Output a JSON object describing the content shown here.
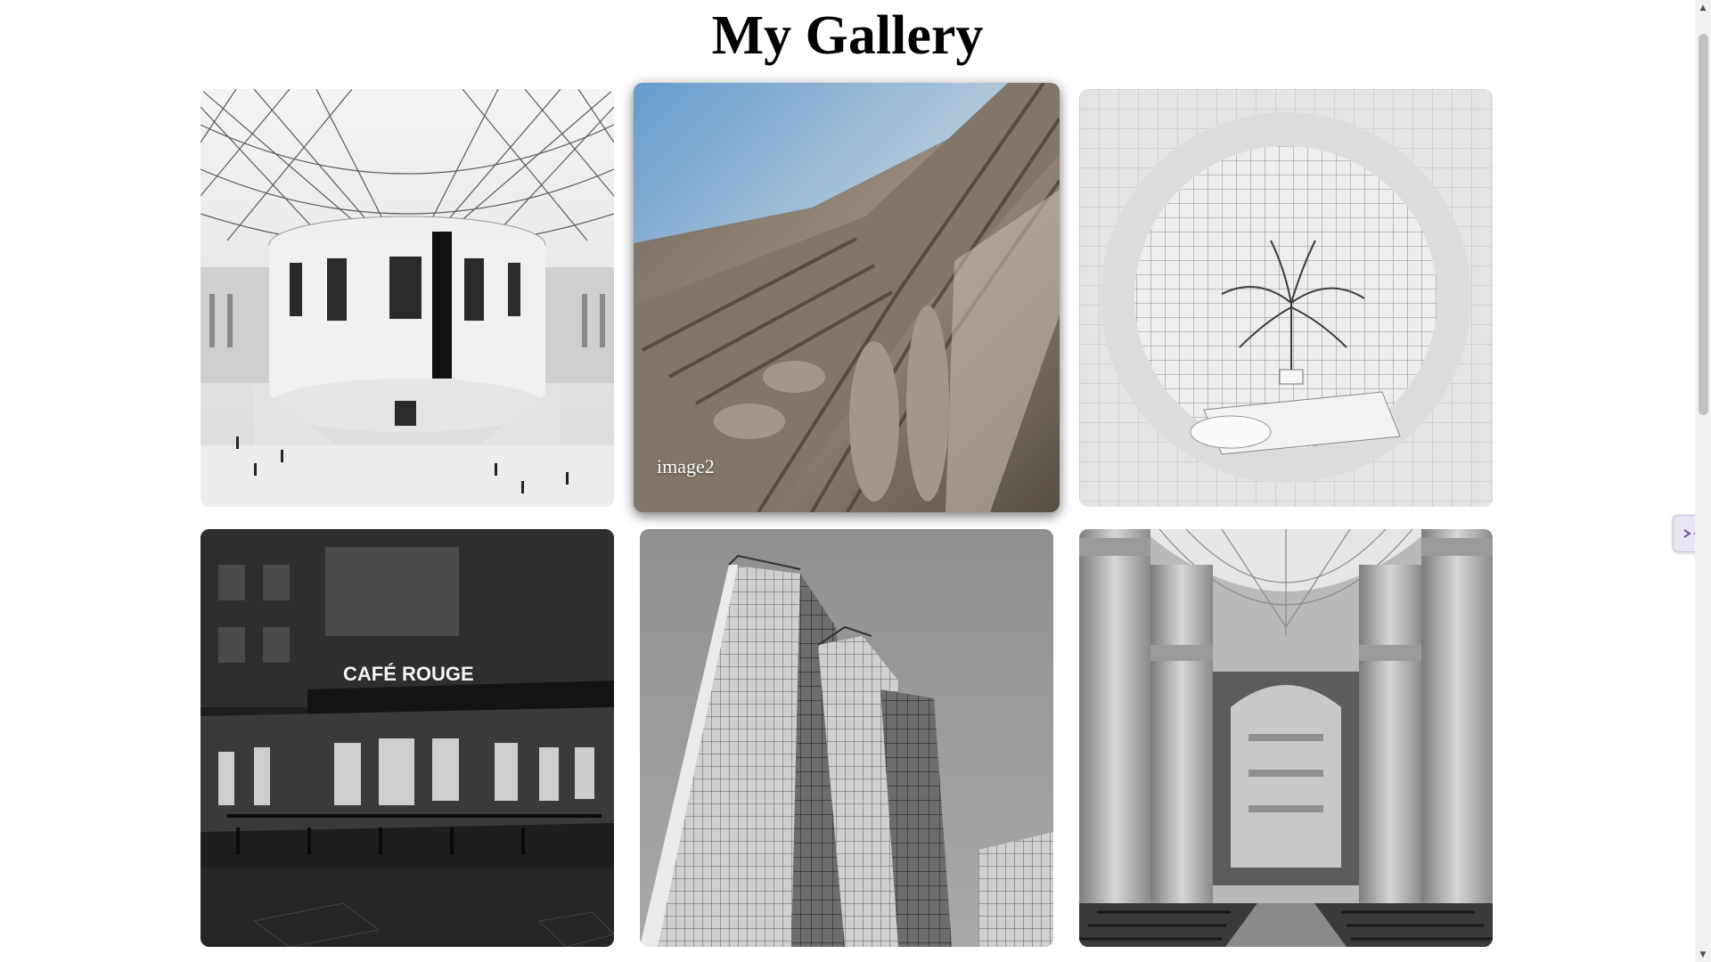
{
  "page": {
    "title": "My Gallery"
  },
  "gallery": {
    "items": [
      {
        "id": "image1",
        "caption": "",
        "hovered": false
      },
      {
        "id": "image2",
        "caption": "image2",
        "hovered": true
      },
      {
        "id": "image3",
        "caption": "",
        "hovered": false
      },
      {
        "id": "image4",
        "caption": "",
        "hovered": false,
        "sign_text": "CAFÉ ROUGE"
      },
      {
        "id": "image5",
        "caption": "",
        "hovered": false
      },
      {
        "id": "image6",
        "caption": "",
        "hovered": false
      }
    ]
  },
  "icons": {
    "scroll_up": "scroll-up-arrow-icon",
    "scroll_down": "scroll-down-arrow-icon",
    "side_widget": "collapse-arrows-icon"
  }
}
